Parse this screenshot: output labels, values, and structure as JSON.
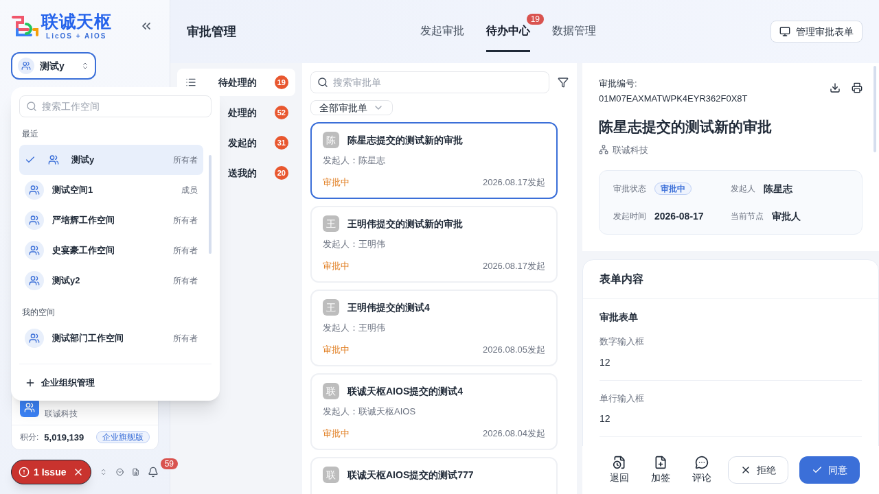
{
  "brand": {
    "name": "联诚天枢",
    "tagline": "LicOS + AIOS"
  },
  "workspace": {
    "name": "测试y"
  },
  "dropdown": {
    "search_placeholder": "搜索工作空间",
    "groups": [
      {
        "title": "最近",
        "items": [
          {
            "name": "测试y",
            "role": "所有者",
            "selected": true
          },
          {
            "name": "测试空间1",
            "role": "成员",
            "selected": false
          },
          {
            "name": "严培辉工作空间",
            "role": "所有者",
            "selected": false
          },
          {
            "name": "史宴豪工作空间",
            "role": "所有者",
            "selected": false
          },
          {
            "name": "测试y2",
            "role": "所有者",
            "selected": false
          }
        ]
      },
      {
        "title": "我的空间",
        "items": [
          {
            "name": "测试部门工作空间",
            "role": "所有者",
            "selected": false
          }
        ]
      }
    ],
    "footer": "企业组织管理"
  },
  "org_card": {
    "company": "联诚科技",
    "points_label": "积分:",
    "points": "5,019,139",
    "plan": "企业旗舰版"
  },
  "issue_badge": "1 Issue",
  "notifications": "59",
  "header": {
    "title": "审批管理",
    "tabs": [
      {
        "label": "发起审批",
        "selected": false
      },
      {
        "label": "待办中心",
        "selected": true,
        "badge": "19"
      },
      {
        "label": "数据管理",
        "selected": false
      }
    ],
    "button": "管理审批表单"
  },
  "nav": [
    {
      "label": "待处理的",
      "count": "19",
      "selected": true
    },
    {
      "label": "处理的",
      "count": "52",
      "selected": false
    },
    {
      "label": "发起的",
      "count": "31",
      "selected": false
    },
    {
      "label": "送我的",
      "count": "20",
      "selected": false
    }
  ],
  "list": {
    "search_placeholder": "搜索审批单",
    "filter": "全部审批单",
    "items": [
      {
        "avatar": "陈",
        "title": "陈星志提交的测试新的审批",
        "initiator": "发起人：陈星志",
        "status": "审批中",
        "date": "2026.08.17发起",
        "selected": true
      },
      {
        "avatar": "王",
        "title": "王明伟提交的测试新的审批",
        "initiator": "发起人：王明伟",
        "status": "审批中",
        "date": "2026.08.17发起",
        "selected": false
      },
      {
        "avatar": "王",
        "title": "王明伟提交的测试4",
        "initiator": "发起人：王明伟",
        "status": "审批中",
        "date": "2026.08.05发起",
        "selected": false
      },
      {
        "avatar": "联",
        "title": "联诚天枢AIOS提交的测试4",
        "initiator": "发起人：联诚天枢AIOS",
        "status": "审批中",
        "date": "2026.08.04发起",
        "selected": false
      },
      {
        "avatar": "联",
        "title": "联诚天枢AIOS提交的测试777"
      }
    ]
  },
  "detail": {
    "number_label": "审批编号:",
    "number": "01M07EAXMATWPK4EYR362F0X8T",
    "title": "陈星志提交的测试新的审批",
    "org": "联诚科技",
    "info": [
      {
        "label": "审批状态",
        "value": "审批中",
        "kind": "tag"
      },
      {
        "label": "发起人",
        "value": "陈星志",
        "kind": "text"
      },
      {
        "label": "发起时间",
        "value": "2026-08-17",
        "kind": "text"
      },
      {
        "label": "当前节点",
        "value": "审批人",
        "kind": "text"
      }
    ],
    "form_title": "表单内容",
    "form_section": "审批表单",
    "fields": [
      {
        "label": "数字输入框",
        "value": "12"
      },
      {
        "label": "单行输入框",
        "value": "12"
      }
    ],
    "actions": [
      {
        "label": "退回",
        "kind": "return"
      },
      {
        "label": "加签",
        "kind": "add"
      },
      {
        "label": "评论",
        "kind": "comment"
      }
    ],
    "reject": "拒绝",
    "approve": "同意"
  }
}
